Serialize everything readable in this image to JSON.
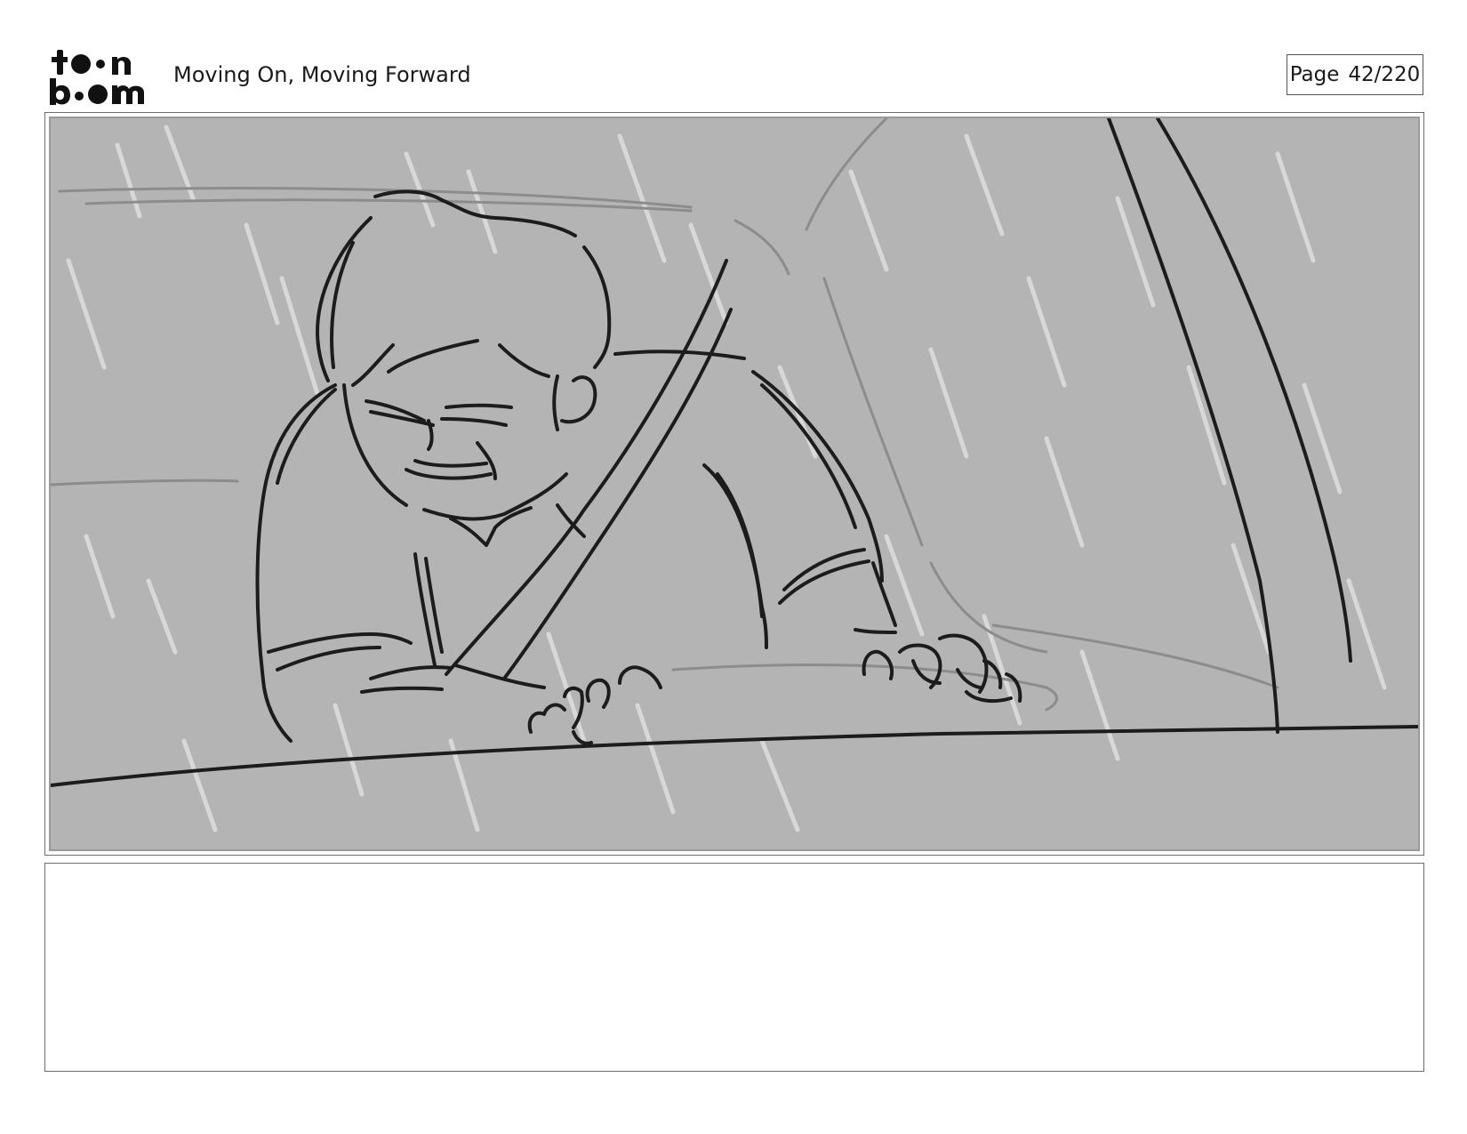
{
  "header": {
    "logo": {
      "brand": "toon boom",
      "icon": "toon-boom-logo"
    },
    "title": "Moving On, Moving Forward",
    "page_label": "Page",
    "page_number": "42/220"
  },
  "panel": {
    "image": {
      "icon": "storyboard-sketch",
      "background_color": "#b4b4b4",
      "line_color": "#1c1c1c",
      "rain_color": "#e6e6e6"
    }
  },
  "notes": {
    "text": ""
  }
}
